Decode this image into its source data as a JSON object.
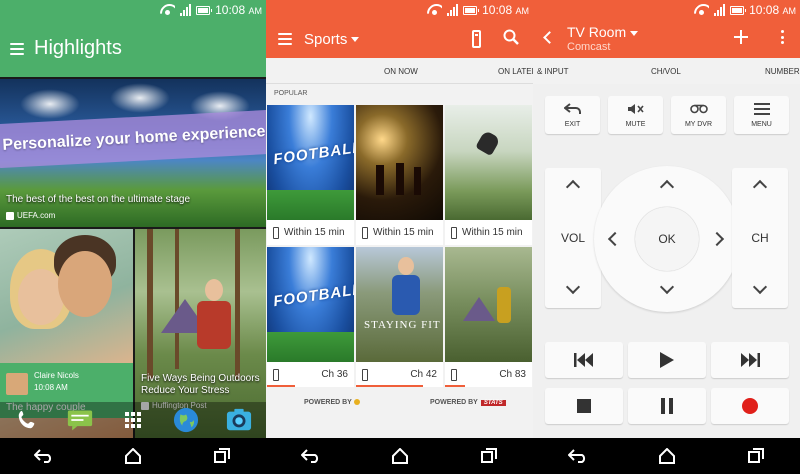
{
  "status": {
    "time": "10:08",
    "ampm": "AM"
  },
  "highlights": {
    "title": "Highlights",
    "hero": {
      "banner": "Personalize your home experience",
      "caption": "The best of the best on the ultimate stage",
      "source": "UEFA.com"
    },
    "couple": {
      "author": "Claire Nicols",
      "time": "10:08 AM",
      "caption": "The happy couple"
    },
    "outdoors": {
      "caption": "Five Ways Being Outdoors Reduce Your Stress",
      "source": "Huffington Post"
    },
    "dock": [
      "phone-icon",
      "messages-icon",
      "apps-grid-icon",
      "browser-globe-icon",
      "camera-icon"
    ]
  },
  "sports": {
    "title": "Sports",
    "tabs": {
      "on_now": "ON NOW",
      "later": "ON LATER"
    },
    "section": "POPULAR",
    "cards": [
      {
        "label": "Within 15 min",
        "thumb_text": "FOOTBALL"
      },
      {
        "label": "Within 15 min",
        "thumb_text": ""
      },
      {
        "label": "Within 15 min",
        "thumb_text": ""
      },
      {
        "label": "Ch 36",
        "thumb_text": "FOOTBALL"
      },
      {
        "label": "Ch 42",
        "thumb_text": "STAYING FIT"
      },
      {
        "label": "Ch 83",
        "thumb_text": ""
      }
    ],
    "powered_by": "POWERED BY",
    "stats_logo": "STATS"
  },
  "remote": {
    "title": "TV Room",
    "subtitle": "Comcast",
    "tabs": [
      "& INPUT",
      "CH/VOL",
      "NUMBER"
    ],
    "buttons": {
      "exit": "EXIT",
      "mute": "MUTE",
      "dvr": "MY DVR",
      "menu": "MENU"
    },
    "vol": "VOL",
    "ch": "CH",
    "ok": "OK"
  },
  "colors": {
    "green": "#4caf6a",
    "orange": "#f05f3a",
    "record": "#e0201a"
  }
}
